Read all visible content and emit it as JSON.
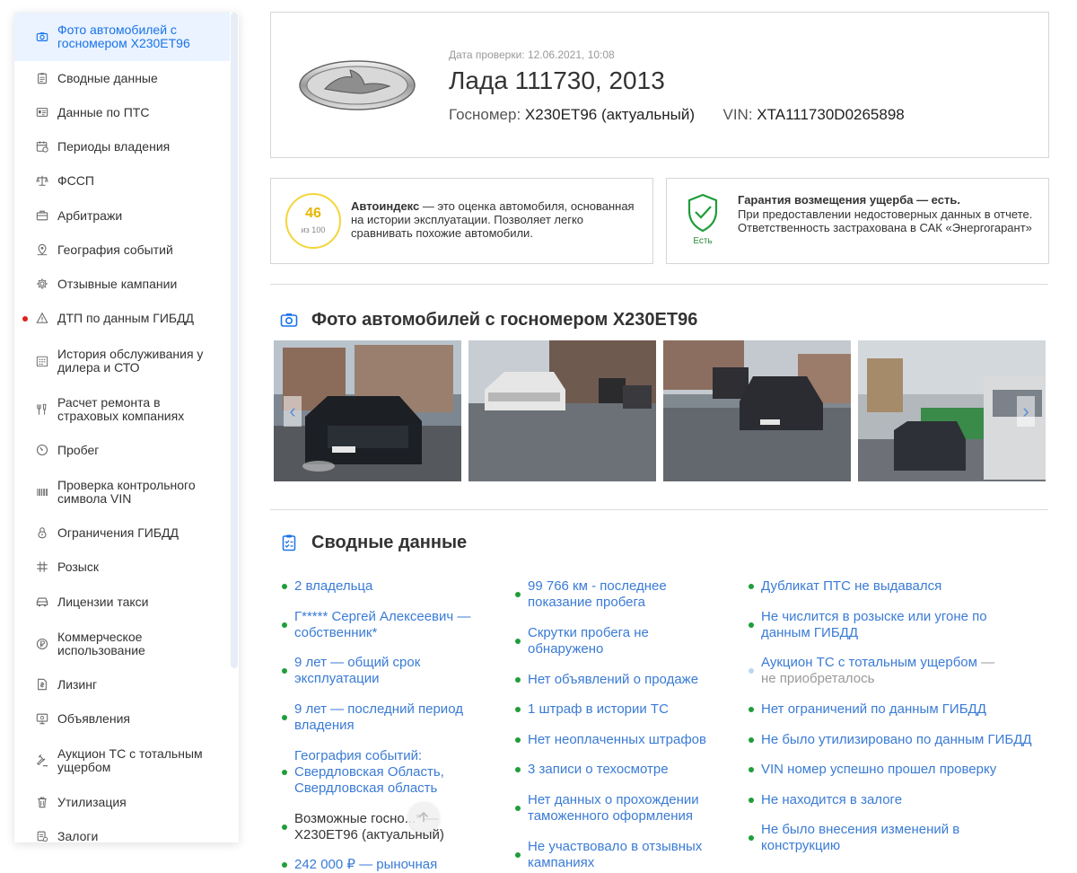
{
  "sidebar": {
    "items": [
      {
        "label": "Фото автомобилей с госномером Х230ЕТ96",
        "icon": "camera-icon",
        "active": true
      },
      {
        "label": "Сводные данные",
        "icon": "clipboard-icon"
      },
      {
        "label": "Данные по ПТС",
        "icon": "id-card-icon"
      },
      {
        "label": "Периоды владения",
        "icon": "calendar-icon"
      },
      {
        "label": "ФССП",
        "icon": "scales-icon"
      },
      {
        "label": "Арбитражи",
        "icon": "briefcase-icon"
      },
      {
        "label": "География событий",
        "icon": "map-pin-icon"
      },
      {
        "label": "Отзывные кампании",
        "icon": "gear-icon"
      },
      {
        "label": "ДТП по данным ГИБДД",
        "icon": "warning-icon",
        "alert": true
      },
      {
        "label": "История обслуживания у дилера и СТО",
        "icon": "calendar-grid-icon"
      },
      {
        "label": "Расчет ремонта в страховых компаниях",
        "icon": "tools-icon"
      },
      {
        "label": "Пробег",
        "icon": "speedometer-icon"
      },
      {
        "label": "Проверка контрольного символа VIN",
        "icon": "barcode-icon"
      },
      {
        "label": "Ограничения ГИБДД",
        "icon": "lock-icon"
      },
      {
        "label": "Розыск",
        "icon": "hash-icon"
      },
      {
        "label": "Лицензии такси",
        "icon": "taxi-icon"
      },
      {
        "label": "Коммерческое использование",
        "icon": "ruble-icon"
      },
      {
        "label": "Лизинг",
        "icon": "document-dollar-icon"
      },
      {
        "label": "Объявления",
        "icon": "announcement-icon"
      },
      {
        "label": "Аукцион ТС с тотальным ущербом",
        "icon": "gavel-icon"
      },
      {
        "label": "Утилизация",
        "icon": "trash-icon"
      },
      {
        "label": "Залоги",
        "icon": "pledge-icon"
      }
    ]
  },
  "header": {
    "check_date": "Дата проверки: 12.06.2021, 10:08",
    "car_title": "Лада 111730, 2013",
    "plate_label": "Госномер:",
    "plate_value": "Х230ЕТ96 (актуальный)",
    "vin_label": "VIN:",
    "vin_value": "XTA111730D0265898"
  },
  "autoindex": {
    "score": "46",
    "score_of": "из 100",
    "title": "Автоиндекс",
    "text": " — это оценка автомобиля, основанная на истории эксплуатации. Позволяет легко сравнивать похожие автомобили."
  },
  "guarantee": {
    "badge": "Есть",
    "title": "Гарантия возмещения ущерба — есть.",
    "text": "При предоставлении недостоверных данных в отчете. Ответственность застрахована в САК «Энергогарант»"
  },
  "photos_section": {
    "title": "Фото автомобилей с госномером Х230ЕТ96"
  },
  "summary": {
    "title": "Сводные данные",
    "col1": [
      {
        "text": "2 владельца"
      },
      {
        "text": "Г***** Сергей Алексеевич — собственник*"
      },
      {
        "text": "9 лет — общий срок эксплуатации"
      },
      {
        "text": "9 лет — последний период владения"
      },
      {
        "text": "География событий: Свердловская Область, Свердловская область"
      },
      {
        "text": "Возможные госно...* — Х230ЕТ96 (актуальный)"
      },
      {
        "text": "242 000 ₽ — рыночная"
      }
    ],
    "col2": [
      {
        "text": "99 766 км - последнее показание пробега"
      },
      {
        "text": "Скрутки пробега не обнаружено"
      },
      {
        "text": "Нет объявлений о продаже"
      },
      {
        "text": "1 штраф в истории ТС"
      },
      {
        "text": "Нет неоплаченных штрафов"
      },
      {
        "text": "3 записи о техосмотре"
      },
      {
        "text": "Нет данных о прохождении таможенного оформления"
      },
      {
        "text": "Не участвовало в отзывных кампаниях"
      }
    ],
    "col3": [
      {
        "text": "Дубликат ПТС не выдавался"
      },
      {
        "text": "Не числится в розыске или угоне по данным ГИБДД"
      },
      {
        "text": "Аукцион ТС с тотальным ущербом",
        "suffix": " — не приобреталось"
      },
      {
        "text": "Нет ограничений по данным ГИБДД"
      },
      {
        "text": "Не было утилизировано по данным ГИБДД"
      },
      {
        "text": "VIN номер успешно прошел проверку"
      },
      {
        "text": "Не находится в залоге"
      },
      {
        "text": "Не было внесения изменений в конструкцию"
      }
    ]
  },
  "colors": {
    "accent": "#1a73e8",
    "link": "#3a7bd5",
    "ok": "#1f9d3a",
    "alert": "#e0201f",
    "score": "#e8b500"
  }
}
